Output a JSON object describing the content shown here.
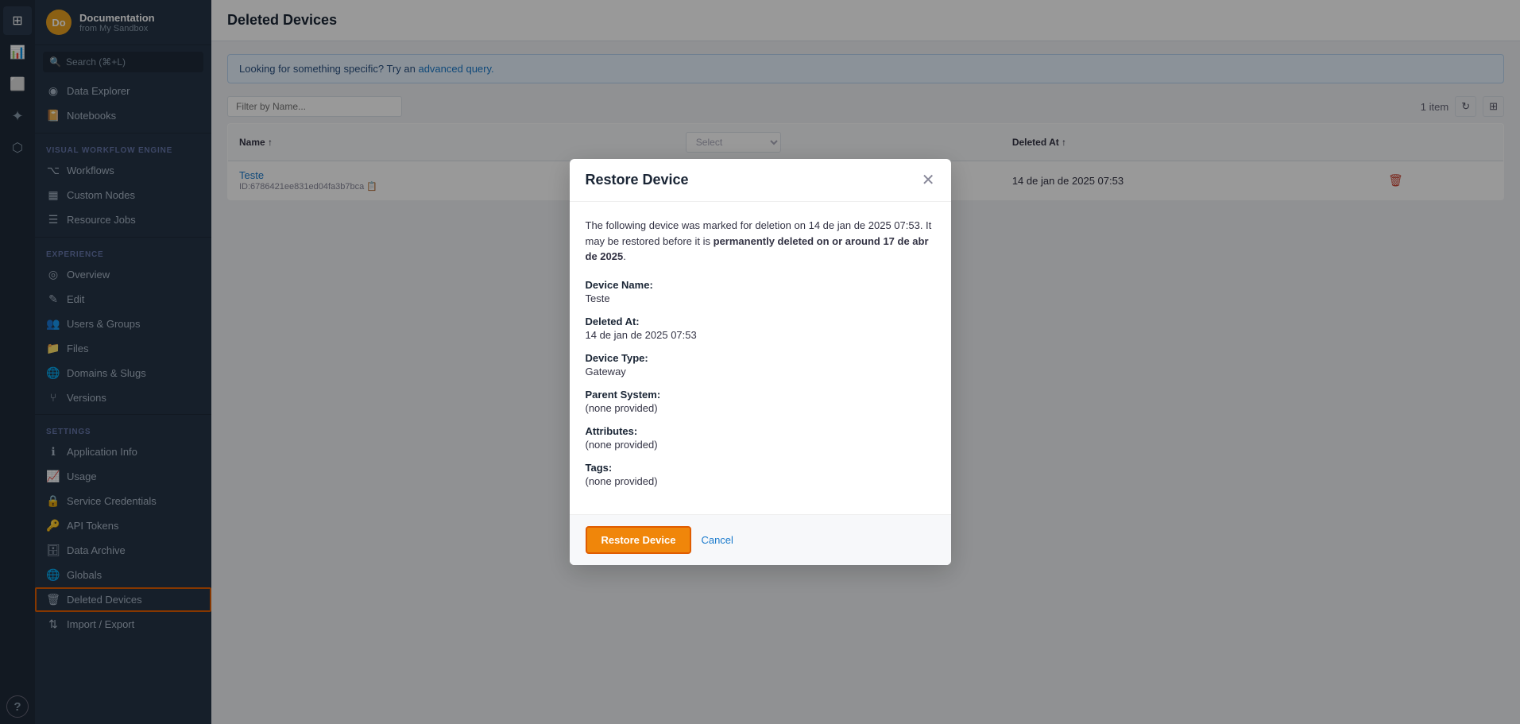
{
  "iconBar": {
    "items": [
      {
        "name": "grid-icon",
        "symbol": "⊞",
        "active": true
      },
      {
        "name": "chart-icon",
        "symbol": "📊",
        "active": false
      },
      {
        "name": "box-icon",
        "symbol": "⬜",
        "active": false
      },
      {
        "name": "node-icon",
        "symbol": "✦",
        "active": false
      },
      {
        "name": "puzzle-icon",
        "symbol": "⬡",
        "active": false
      },
      {
        "name": "help-icon",
        "symbol": "?",
        "active": false
      }
    ]
  },
  "sidebar": {
    "appName": "Documentation",
    "appSub": "from My Sandbox",
    "avatarInitials": "Do",
    "searchPlaceholder": "Search (⌘+L)",
    "sections": [
      {
        "label": "",
        "items": [
          {
            "name": "data-explorer",
            "icon": "◉",
            "label": "Data Explorer"
          },
          {
            "name": "notebooks",
            "icon": "📓",
            "label": "Notebooks"
          }
        ]
      },
      {
        "label": "VISUAL WORKFLOW ENGINE",
        "items": [
          {
            "name": "workflows",
            "icon": "⌥",
            "label": "Workflows"
          },
          {
            "name": "custom-nodes",
            "icon": "▦",
            "label": "Custom Nodes"
          },
          {
            "name": "resource-jobs",
            "icon": "☰",
            "label": "Resource Jobs"
          }
        ]
      },
      {
        "label": "EXPERIENCE",
        "items": [
          {
            "name": "overview",
            "icon": "◎",
            "label": "Overview"
          },
          {
            "name": "edit",
            "icon": "✎",
            "label": "Edit"
          },
          {
            "name": "users-groups",
            "icon": "👥",
            "label": "Users & Groups"
          },
          {
            "name": "files",
            "icon": "📁",
            "label": "Files"
          },
          {
            "name": "domains-slugs",
            "icon": "🌐",
            "label": "Domains & Slugs"
          },
          {
            "name": "versions",
            "icon": "⑂",
            "label": "Versions"
          }
        ]
      },
      {
        "label": "SETTINGS",
        "items": [
          {
            "name": "application-info",
            "icon": "ℹ",
            "label": "Application Info"
          },
          {
            "name": "usage",
            "icon": "📈",
            "label": "Usage"
          },
          {
            "name": "service-credentials",
            "icon": "🔒",
            "label": "Service Credentials"
          },
          {
            "name": "api-tokens",
            "icon": "🔑",
            "label": "API Tokens"
          },
          {
            "name": "data-archive",
            "icon": "🗄",
            "label": "Data Archive"
          },
          {
            "name": "globals",
            "icon": "🌐",
            "label": "Globals"
          },
          {
            "name": "deleted-devices",
            "icon": "🗑",
            "label": "Deleted Devices",
            "highlighted": true
          },
          {
            "name": "import-export",
            "icon": "⇅",
            "label": "Import / Export"
          }
        ]
      }
    ]
  },
  "mainHeader": {
    "title": "Deleted Devices"
  },
  "infoBar": {
    "text": "Looking for something specific? Try an",
    "linkText": "advanced query.",
    "suffix": ""
  },
  "tableControls": {
    "filterPlaceholder": "Filter by Name...",
    "itemCount": "1 item",
    "refreshIcon": "↻",
    "columnsIcon": "⊞"
  },
  "tableHeaders": [
    {
      "label": "Name",
      "sortable": true
    },
    {
      "label": ""
    },
    {
      "label": "Deleted At",
      "sortable": true
    }
  ],
  "tableRows": [
    {
      "name": "Teste",
      "id": "ID:6786421ee831ed04fa3b7bca",
      "deletedAt": "14 de jan de 2025 07:53"
    }
  ],
  "modal": {
    "title": "Restore Device",
    "intro": "The following device was marked for deletion on 14 de jan de 2025 07:53. It may be restored before it is",
    "introBold": "permanently deleted on or around 17 de abr de 2025",
    "introPeriod": ".",
    "fields": [
      {
        "label": "Device Name:",
        "value": "Teste"
      },
      {
        "label": "Deleted At:",
        "value": "14 de jan de 2025 07:53"
      },
      {
        "label": "Device Type:",
        "value": "Gateway"
      },
      {
        "label": "Parent System:",
        "value": "(none provided)"
      },
      {
        "label": "Attributes:",
        "value": "(none provided)"
      },
      {
        "label": "Tags:",
        "value": "(none provided)"
      }
    ],
    "restoreLabel": "Restore Device",
    "cancelLabel": "Cancel"
  }
}
